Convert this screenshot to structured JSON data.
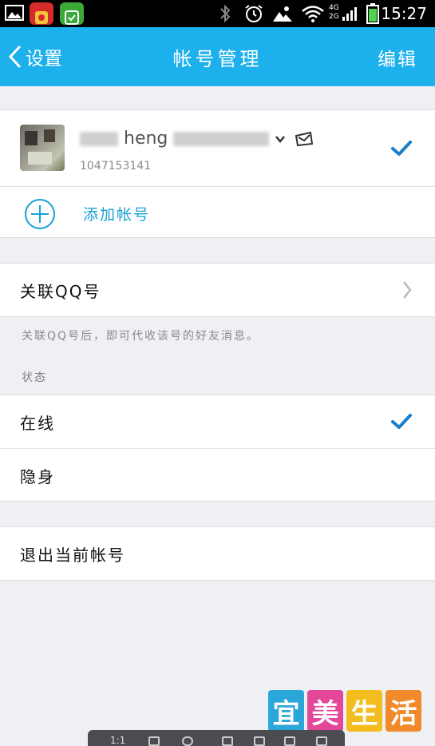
{
  "status_bar": {
    "time": "15:27",
    "network_labels": [
      "4G",
      "2G"
    ],
    "icons": [
      "gallery-icon",
      "wallet-app-icon",
      "security-app-icon",
      "bluetooth-icon",
      "alarm-icon",
      "weather-icon",
      "wifi-icon",
      "signal-icon",
      "battery-icon"
    ]
  },
  "nav": {
    "back_label": "设置",
    "title": "帐号管理",
    "edit_label": "编辑"
  },
  "account": {
    "name_visible": "heng",
    "id": "1047153141",
    "selected": true
  },
  "add_account": {
    "label": "添加帐号"
  },
  "linked_qq": {
    "label": "关联QQ号",
    "hint": "关联QQ号后，即可代收该号的好友消息。"
  },
  "status_section": {
    "header": "状态",
    "options": [
      {
        "label": "在线",
        "selected": true
      },
      {
        "label": "隐身",
        "selected": false
      }
    ]
  },
  "logout": {
    "label": "退出当前帐号"
  },
  "watermark": {
    "chars": [
      "宜",
      "美",
      "生",
      "活"
    ]
  },
  "viewer_bar": {
    "zoom": "1:1"
  },
  "colors": {
    "accent": "#1cb0ec",
    "check": "#1a7fc8",
    "background": "#eff0f3"
  }
}
